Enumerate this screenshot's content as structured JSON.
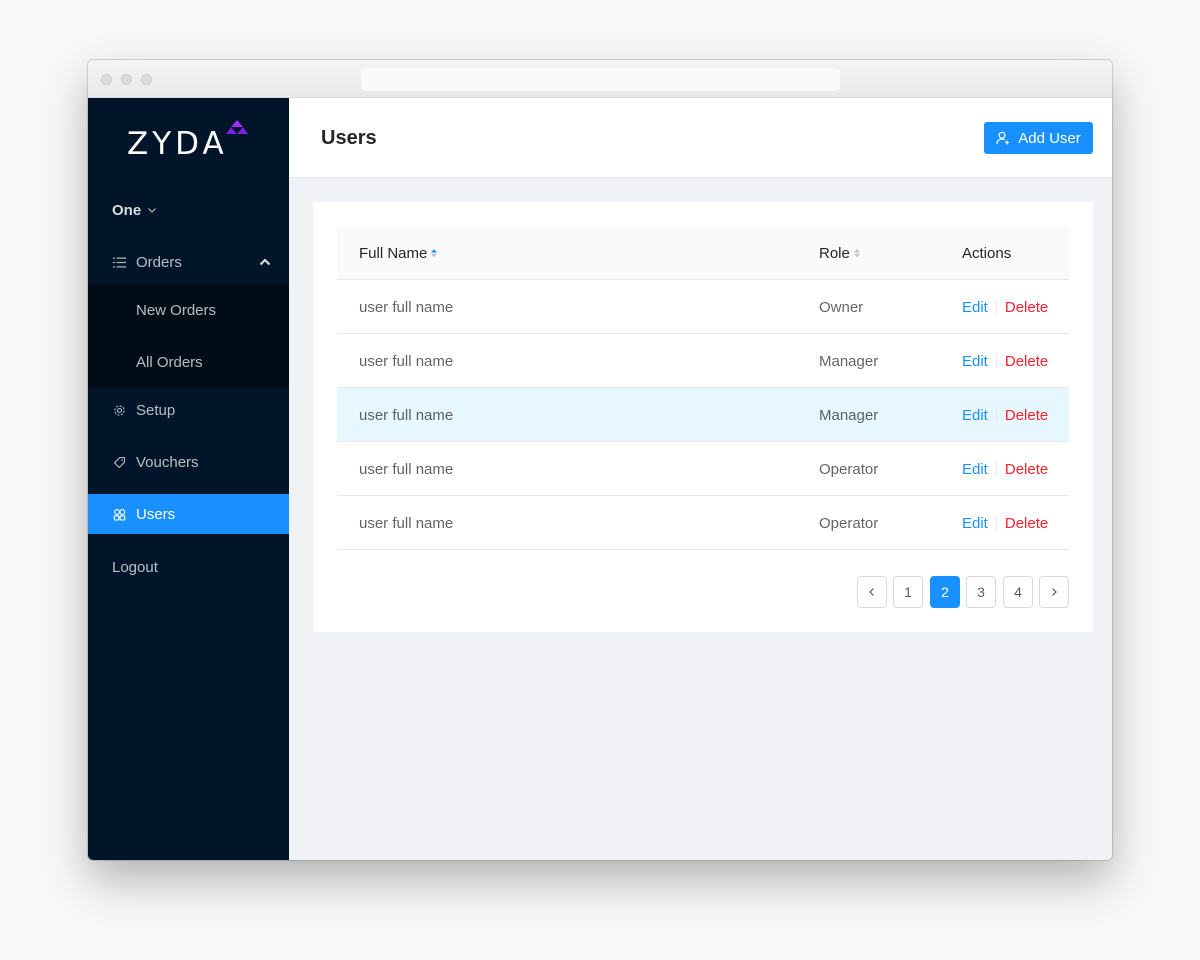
{
  "app": {
    "logo_text": "ZYDA",
    "accent_color": "#1890ff",
    "sidebar_color": "#001529",
    "logo_mark_color": "#8a2be2"
  },
  "sidebar": {
    "org_selector": "One",
    "orders": {
      "label": "Orders",
      "icon": "list-icon",
      "expanded": true
    },
    "orders_submenu": [
      "New Orders",
      "All Orders"
    ],
    "setup": {
      "label": "Setup",
      "icon": "gear-icon"
    },
    "vouchers": {
      "label": "Vouchers",
      "icon": "tag-icon"
    },
    "users": {
      "label": "Users",
      "icon": "team-icon",
      "active": true
    },
    "logout": "Logout"
  },
  "header": {
    "title": "Users",
    "add_button": "Add User"
  },
  "table": {
    "columns": {
      "name": "Full Name",
      "role": "Role",
      "actions": "Actions"
    },
    "sort": {
      "column": "Full Name",
      "direction": "ascending"
    },
    "rows": [
      {
        "name": "user full name",
        "role": "Owner",
        "edit": "Edit",
        "delete": "Delete",
        "highlighted": false
      },
      {
        "name": "user full name",
        "role": "Manager",
        "edit": "Edit",
        "delete": "Delete",
        "highlighted": false
      },
      {
        "name": "user full name",
        "role": "Manager",
        "edit": "Edit",
        "delete": "Delete",
        "highlighted": true
      },
      {
        "name": "user full name",
        "role": "Operator",
        "edit": "Edit",
        "delete": "Delete",
        "highlighted": false
      },
      {
        "name": "user full name",
        "role": "Operator",
        "edit": "Edit",
        "delete": "Delete",
        "highlighted": false
      }
    ]
  },
  "pagination": {
    "pages": [
      "1",
      "2",
      "3",
      "4"
    ],
    "current": "2"
  }
}
